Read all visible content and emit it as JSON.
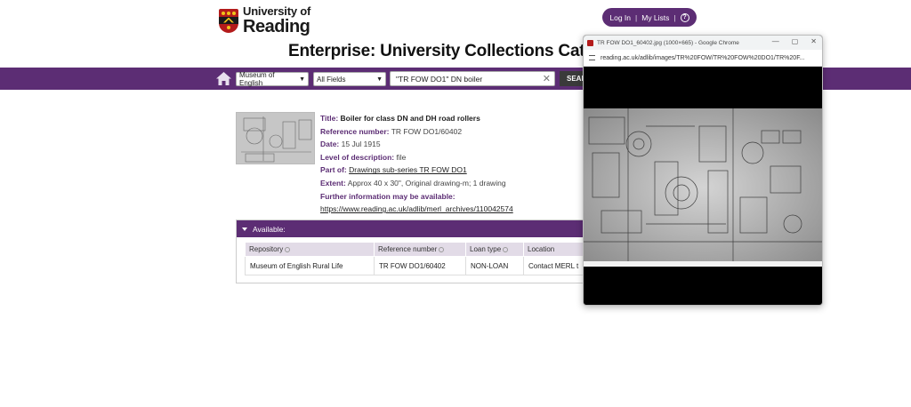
{
  "header": {
    "logo_line1": "University of",
    "logo_line2": "Reading",
    "login": "Log In",
    "separator": "|",
    "mylists": "My Lists",
    "help_glyph": "?"
  },
  "page_title": "Enterprise: University Collections Cata",
  "search": {
    "collection": "Museum of English",
    "field": "All Fields",
    "query": "\"TR FOW DO1\" DN boiler",
    "button": "SEAR"
  },
  "record": {
    "title_label": "Title:",
    "title": "Boiler for class DN and DH road rollers",
    "refnum_label": "Reference number:",
    "refnum": "TR FOW DO1/60402",
    "date_label": "Date:",
    "date": "15 Jul 1915",
    "level_label": "Level of description:",
    "level": "file",
    "partof_label": "Part of:",
    "partof": "Drawings sub-series TR FOW DO1",
    "extent_label": "Extent:",
    "extent": "Approx 40 x 30\", Original drawing-m; 1 drawing",
    "further_label": "Further information may be available:",
    "further_link": "https://www.reading.ac.uk/adlib/merl_archives/110042574"
  },
  "available": {
    "heading": "Available:",
    "columns": [
      "Repository",
      "Reference number",
      "Loan type",
      "Location"
    ],
    "row": [
      "Museum of English Rural Life",
      "TR FOW DO1/60402",
      "NON-LOAN",
      "Contact MERL t"
    ]
  },
  "popup": {
    "window_title": "TR FOW DO1_60402.jpg (1000×665) - Google Chrome",
    "url": "reading.ac.uk/adlib/images/TR%20FOW/TR%20FOW%20DO1/TR%20F..."
  },
  "colors": {
    "brand_purple": "#5c2d74",
    "crest_red": "#b31b1b"
  }
}
